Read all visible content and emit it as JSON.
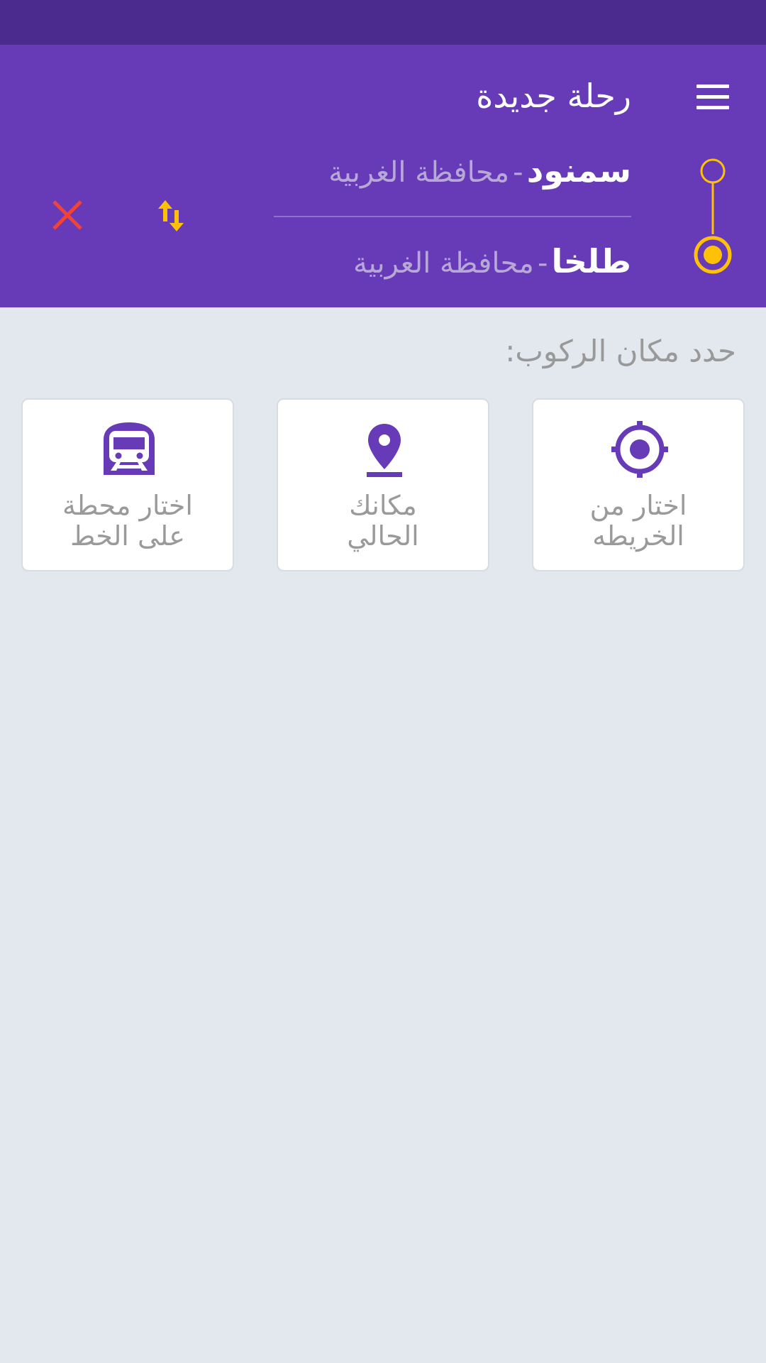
{
  "header": {
    "title": "رحلة جديدة",
    "menu_icon": "hamburger-menu-icon",
    "accent_color": "#673ab7",
    "status_bar_color": "#4c2b8f"
  },
  "route": {
    "origin": {
      "name": "سمنود",
      "separator": "-",
      "region": "محافظة الغربية"
    },
    "destination": {
      "name": "طلخا",
      "separator": "-",
      "region": "محافظة الغربية"
    },
    "marker_color": "#ffc107",
    "swap_icon": "swap-vertical-icon",
    "clear_icon": "close-icon",
    "clear_color": "#f44336"
  },
  "pickup": {
    "label": "حدد مكان الركوب:",
    "options": [
      {
        "line1": "اختار من",
        "line2": "الخريطه",
        "icon": "crosshair-target-icon"
      },
      {
        "line1": "مكانك",
        "line2": "الحالي",
        "icon": "location-pin-icon"
      },
      {
        "line1": "اختار محطة",
        "line2": "على الخط",
        "icon": "train-icon"
      }
    ]
  }
}
